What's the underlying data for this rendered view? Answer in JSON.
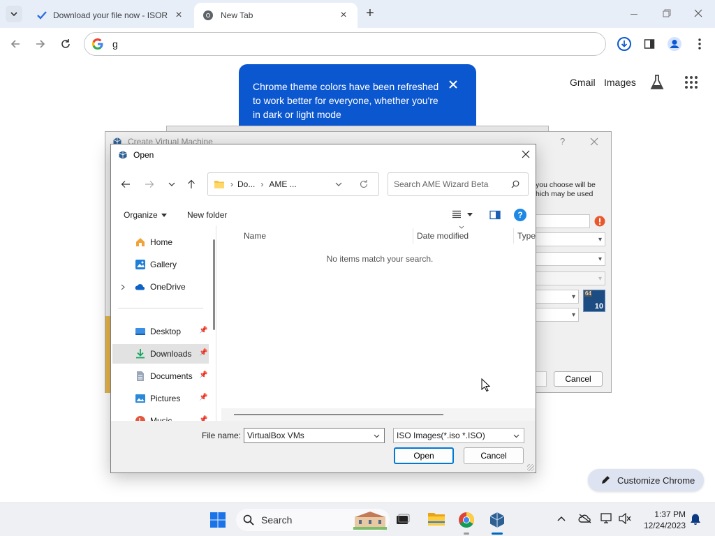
{
  "browser": {
    "tabs": [
      {
        "title": "Download your file now - ISOR",
        "active": false
      },
      {
        "title": "New Tab",
        "active": true
      }
    ],
    "new_tab_symbol": "+",
    "omnibox_value": "g",
    "promo": {
      "text": "Chrome theme colors have been refreshed to work better for everyone, whether you're in dark or light mode"
    },
    "ntp_links": {
      "gmail": "Gmail",
      "images": "Images"
    },
    "customize_label": "Customize Chrome"
  },
  "vbox_dialog": {
    "title": "Create Virtual Machine",
    "help_symbol": "?",
    "text_line1": "you choose will be",
    "text_line2": "hich may be used",
    "os_badge_bits": "64",
    "os_badge_ver": "10",
    "cancel_label": "Cancel"
  },
  "open_dialog": {
    "title": "Open",
    "breadcrumb": [
      "Do...",
      "AME ..."
    ],
    "search_placeholder": "Search AME Wizard Beta",
    "organize_label": "Organize",
    "new_folder_label": "New folder",
    "help_symbol": "?",
    "columns": [
      "Name",
      "Date modified",
      "Type"
    ],
    "empty_message": "No items match your search.",
    "nav_items": [
      {
        "label": "Home",
        "icon": "home-icon",
        "pinned": false
      },
      {
        "label": "Gallery",
        "icon": "gallery-icon",
        "pinned": false
      },
      {
        "label": "OneDrive",
        "icon": "onedrive-icon",
        "pinned": false
      },
      {
        "label": "Desktop",
        "icon": "desktop-icon",
        "pinned": true
      },
      {
        "label": "Downloads",
        "icon": "downloads-icon",
        "pinned": true,
        "selected": true
      },
      {
        "label": "Documents",
        "icon": "documents-icon",
        "pinned": true
      },
      {
        "label": "Pictures",
        "icon": "pictures-icon",
        "pinned": true
      },
      {
        "label": "Music",
        "icon": "music-icon",
        "pinned": true
      }
    ],
    "file_name_label": "File name:",
    "file_name_value": "VirtualBox VMs",
    "file_type_value": "ISO Images(*.iso *.ISO)",
    "open_label": "Open",
    "cancel_label": "Cancel"
  },
  "taskbar": {
    "search_label": "Search",
    "time": "1:37 PM",
    "date": "12/24/2023"
  },
  "colors": {
    "chrome_frame": "#e8eef7",
    "promo_blue": "#0b57d0",
    "accent": "#0078d4",
    "selection": "#e2e2e2"
  }
}
